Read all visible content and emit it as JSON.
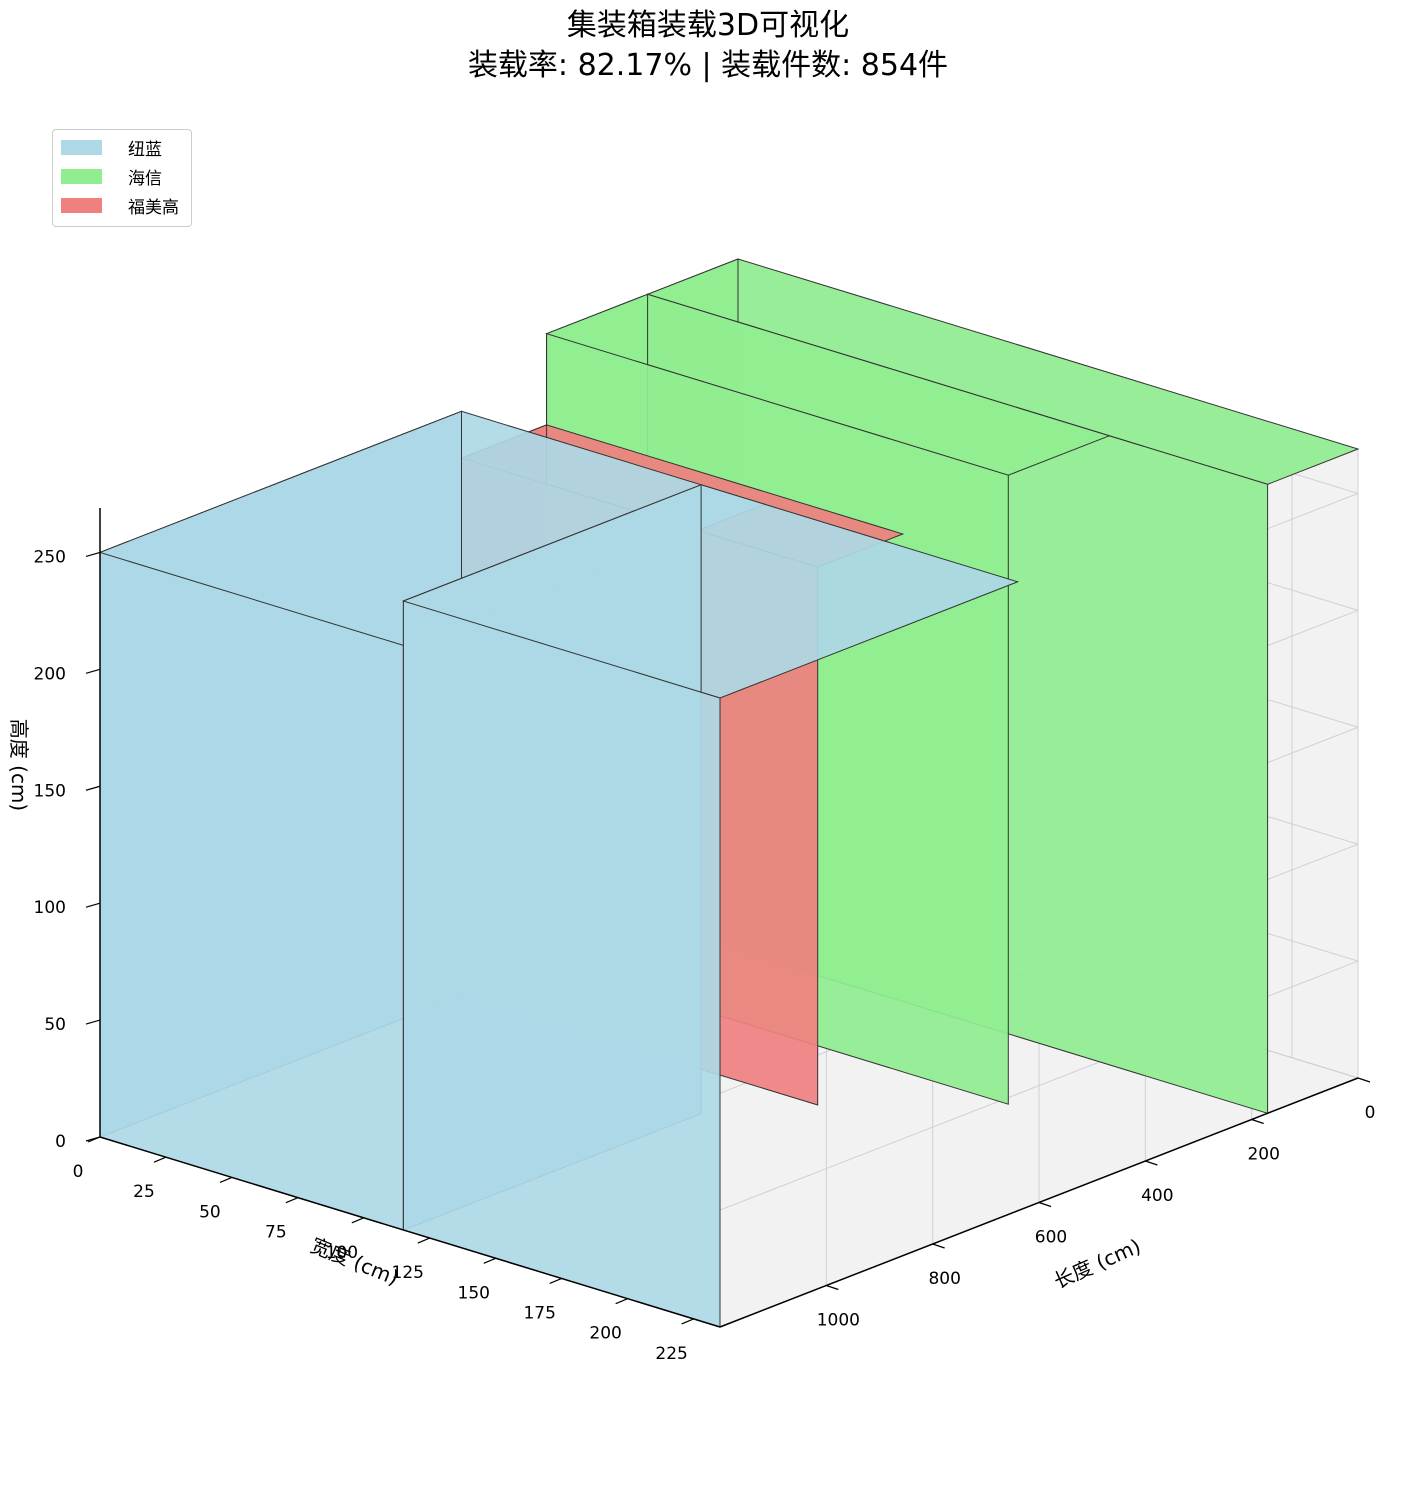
{
  "chart_data": {
    "type": "3d-box-packing",
    "title": "集装箱装载3D可视化",
    "subtitle": "装载率: 82.17% | 装载件数: 854件",
    "loading_rate_percent": 82.17,
    "loaded_count": 854,
    "legend_placement": "top-left",
    "grid": true,
    "axes": {
      "x": {
        "label": "长度 (cm)",
        "range": [
          0,
          1200
        ],
        "ticks": [
          0,
          200,
          400,
          600,
          800,
          1000
        ]
      },
      "y": {
        "label": "宽度 (cm)",
        "range": [
          0,
          235
        ],
        "ticks": [
          0,
          25,
          50,
          75,
          100,
          125,
          150,
          175,
          200,
          225
        ]
      },
      "z": {
        "label": "高度 (cm)",
        "range": [
          0,
          269
        ],
        "ticks": [
          0,
          50,
          100,
          150,
          200,
          250
        ]
      }
    },
    "series": [
      {
        "name": "纽蓝",
        "color": "#add8e6"
      },
      {
        "name": "海信",
        "color": "#90ee90"
      },
      {
        "name": "福美高",
        "color": "#f08080"
      }
    ],
    "boxes": [
      {
        "brand": "海信",
        "x": [
          0,
          170
        ],
        "y": [
          0,
          235
        ],
        "z": [
          0,
          269
        ]
      },
      {
        "brand": "海信",
        "x": [
          170,
          360
        ],
        "y": [
          60,
          235
        ],
        "z": [
          0,
          269
        ]
      },
      {
        "brand": "福美高",
        "x": [
          360,
          520
        ],
        "y": [
          100,
          235
        ],
        "z": [
          0,
          230
        ]
      },
      {
        "brand": "纽蓝",
        "x": [
          520,
          1200
        ],
        "y": [
          120,
          235
        ],
        "z": [
          0,
          250
        ]
      },
      {
        "brand": "纽蓝",
        "x": [
          640,
          1200
        ],
        "y": [
          0,
          120
        ],
        "z": [
          0,
          269
        ]
      }
    ]
  }
}
